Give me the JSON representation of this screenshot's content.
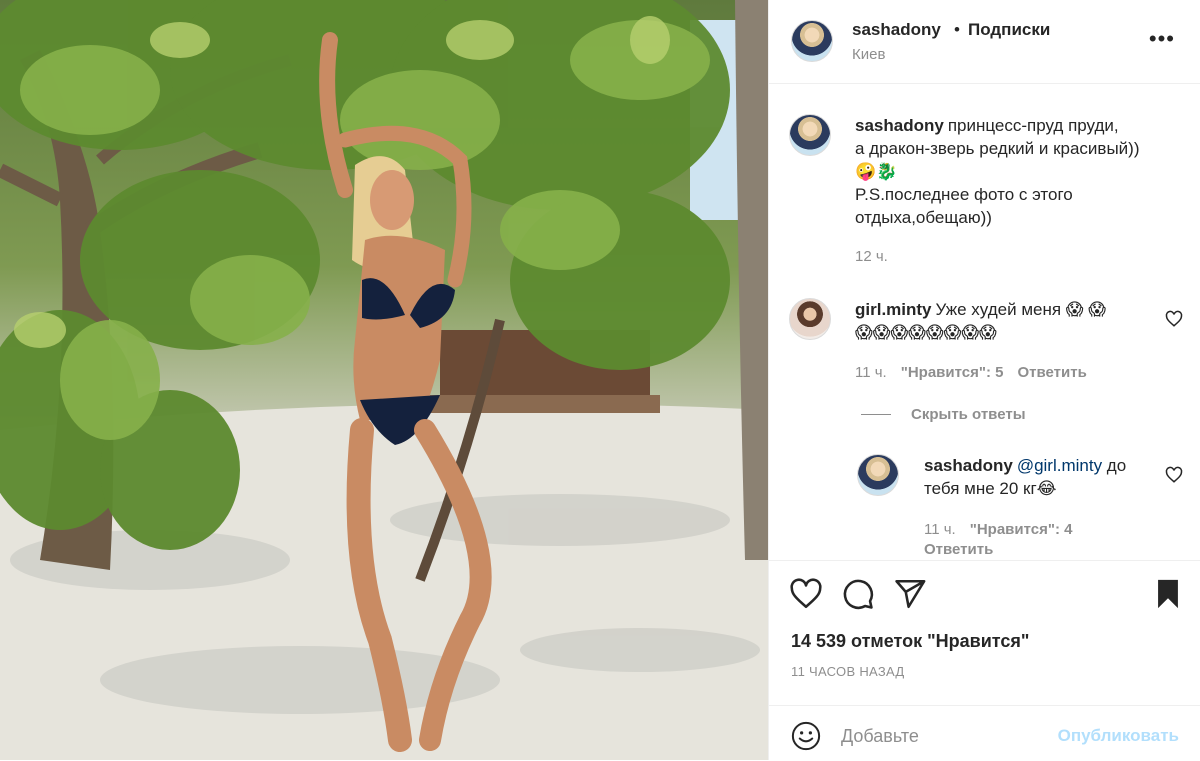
{
  "post": {
    "author": {
      "username": "sashadony",
      "follow_label": "Подписки",
      "location": "Киев"
    },
    "more_label": "•••",
    "photo_alt": "",
    "caption": {
      "username": "sashadony",
      "text_line1": "принцесс-пруд пруди,",
      "text_line2": "а дракон-зверь редкий и красивый))",
      "emojis": "🤪🐉",
      "text_line3": "P.S.последнее фото с этого",
      "text_line4": "отдыха,обещаю))",
      "age": "12 ч."
    },
    "comments": [
      {
        "username": "girl.minty",
        "text": "Уже худей меня 😱 😱",
        "emoji_line": "😱😱😱😱😱😱😱😱",
        "age": "11 ч.",
        "likes": "\"Нравится\": 5",
        "reply_label": "Ответить"
      }
    ],
    "hide_replies_label": "Скрыть ответы",
    "replies": [
      {
        "username": "sashadony",
        "mention": "@girl.minty",
        "text_a": " до",
        "text_b": "тебя мне 20 кг😂",
        "age": "11 ч.",
        "likes": "\"Нравится\": 4",
        "reply_label": "Ответить"
      }
    ],
    "likes_count": "14 539 отметок \"Нравится\"",
    "time_ago": "11 ЧАСОВ НАЗАД",
    "add_comment": {
      "placeholder": "Добавьте",
      "publish_label": "Опубликовать"
    },
    "icons": [
      "more-icon",
      "heart-icon",
      "comment-icon",
      "share-icon",
      "bookmark-icon",
      "emoji-icon"
    ]
  }
}
